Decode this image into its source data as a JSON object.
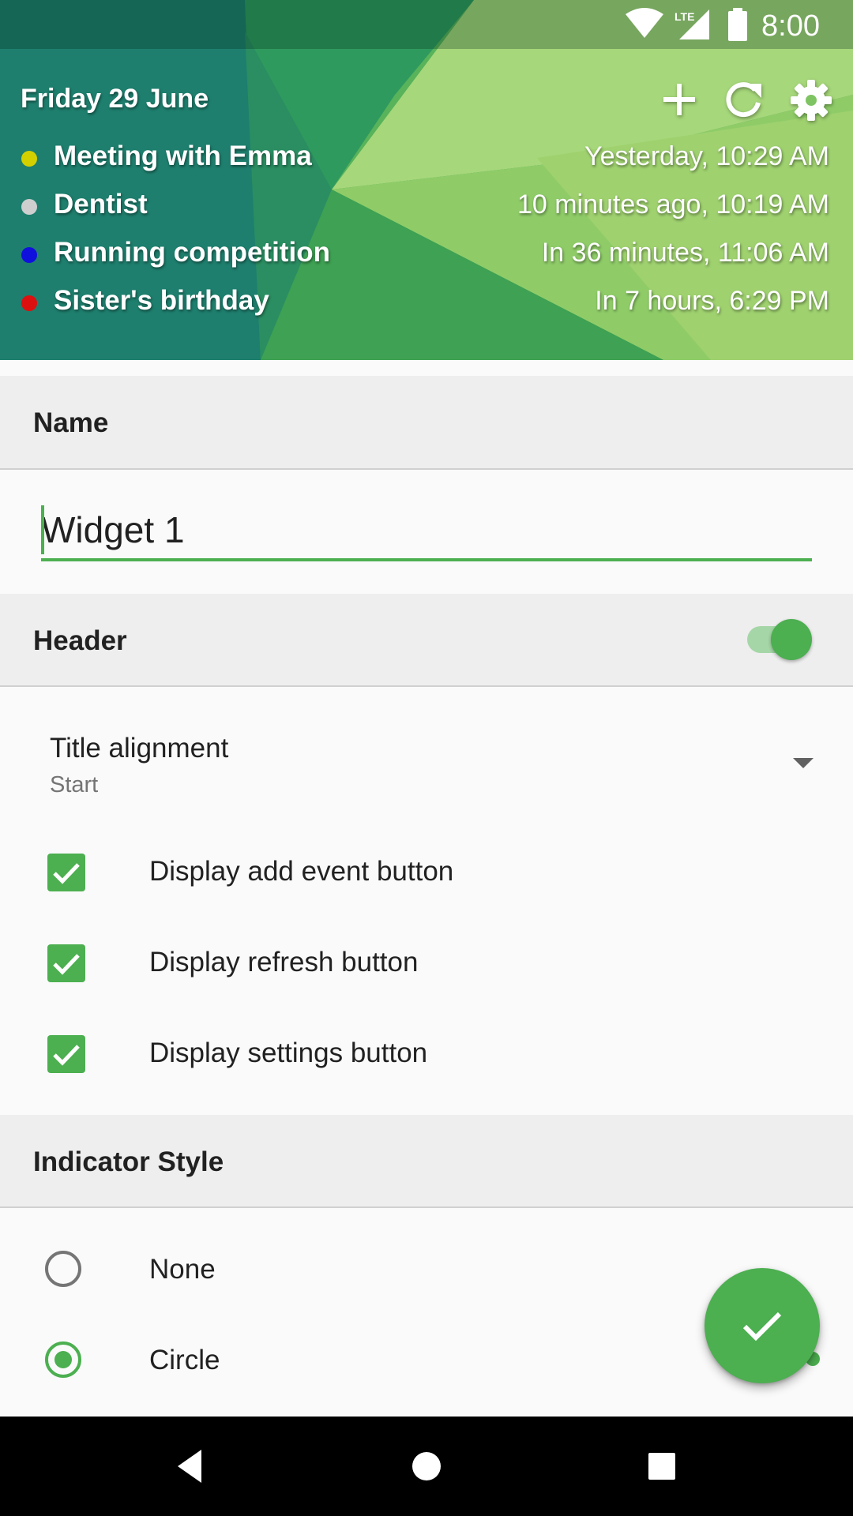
{
  "status_bar": {
    "time": "8:00",
    "network_label": "LTE"
  },
  "widget_preview": {
    "date": "Friday 29 June",
    "buttons": {
      "add": "plus-icon",
      "refresh": "refresh-icon",
      "settings": "gear-icon"
    },
    "events": [
      {
        "title": "Meeting with Emma",
        "time": "Yesterday, 10:29 AM",
        "color": "#d4d000"
      },
      {
        "title": "Dentist",
        "time": "10 minutes ago, 10:19 AM",
        "color": "#cfcfcf"
      },
      {
        "title": "Running competition",
        "time": "In 36 minutes, 11:06 AM",
        "color": "#1010dd"
      },
      {
        "title": "Sister's birthday",
        "time": "In 7 hours, 6:29 PM",
        "color": "#dd1010"
      }
    ]
  },
  "settings": {
    "name_section": {
      "label": "Name",
      "value": "Widget 1"
    },
    "header_section": {
      "label": "Header",
      "toggle_on": true
    },
    "title_alignment": {
      "title": "Title alignment",
      "summary": "Start"
    },
    "checkboxes": [
      {
        "label": "Display add event button",
        "checked": true
      },
      {
        "label": "Display refresh button",
        "checked": true
      },
      {
        "label": "Display settings button",
        "checked": true
      }
    ],
    "indicator_section": {
      "label": "Indicator Style"
    },
    "indicator_options": [
      {
        "label": "None",
        "selected": false
      },
      {
        "label": "Circle",
        "selected": true
      }
    ]
  },
  "fab": {
    "icon": "check-icon"
  },
  "nav_bar": {
    "back": "back-icon",
    "home": "home-icon",
    "recents": "recents-icon"
  },
  "colors": {
    "accent": "#4caf50",
    "section_bg": "#eeeeee"
  }
}
